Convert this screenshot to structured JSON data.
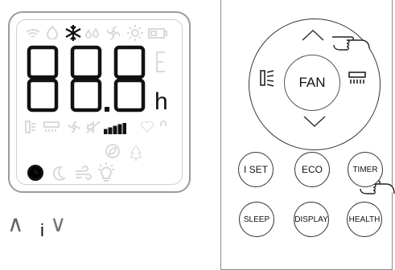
{
  "lcd": {
    "digits": "88.8",
    "unit": "h",
    "icons_top": [
      "wifi-icon",
      "drop-icon",
      "snowflake-icon",
      "dry-icon",
      "fan-icon",
      "sun-icon",
      "battery-icon"
    ],
    "icons_mid": [
      "louver-icon",
      "grid-icon",
      "fan-small-icon",
      "mute-icon",
      "signal-bars-icon",
      "heart-icon",
      "lock-icon"
    ],
    "icons_bottom": [
      "clock-icon",
      "moon-icon",
      "wind-icon",
      "bulb-icon"
    ],
    "active_icons": [
      "snowflake-icon",
      "signal-bars-icon",
      "clock-icon"
    ]
  },
  "remote": {
    "fan_label": "FAN",
    "buttons": [
      {
        "label": "I SET"
      },
      {
        "label": "ECO"
      },
      {
        "label": "TIMER"
      },
      {
        "label": "SLEEP"
      },
      {
        "label": "DISPLAY"
      },
      {
        "label": "HEALTH"
      }
    ]
  },
  "bottom": {
    "up": "∧",
    "i": "i",
    "down": "∨"
  },
  "colors": {
    "active": "#111111",
    "inactive": "#d9d9d9",
    "border": "#9b9b9b"
  }
}
